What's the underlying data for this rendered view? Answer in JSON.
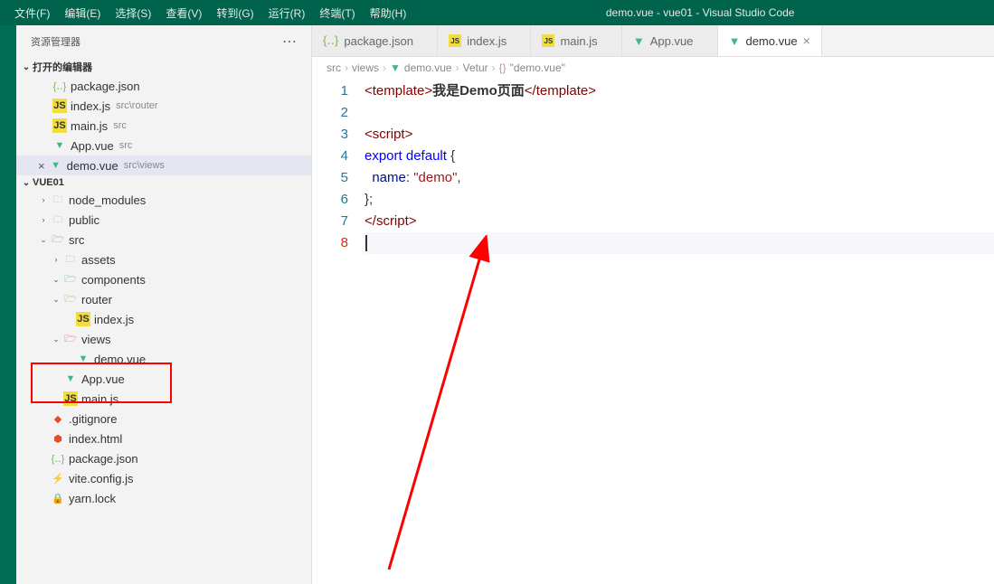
{
  "window": {
    "title": "demo.vue - vue01 - Visual Studio Code"
  },
  "menu": {
    "file": "文件(F)",
    "edit": "编辑(E)",
    "select": "选择(S)",
    "view": "查看(V)",
    "goto": "转到(G)",
    "run": "运行(R)",
    "terminal": "终端(T)",
    "help": "帮助(H)"
  },
  "sidebar": {
    "title": "资源管理器",
    "sections": {
      "open_editors": "打开的编辑器",
      "project": "VUE01"
    },
    "open_editors": [
      {
        "name": "package.json",
        "desc": "",
        "icon": "json"
      },
      {
        "name": "index.js",
        "desc": "src\\router",
        "icon": "js"
      },
      {
        "name": "main.js",
        "desc": "src",
        "icon": "js"
      },
      {
        "name": "App.vue",
        "desc": "src",
        "icon": "vue"
      },
      {
        "name": "demo.vue",
        "desc": "src\\views",
        "icon": "vue",
        "active": true
      }
    ],
    "tree": [
      {
        "label": "node_modules",
        "type": "folder",
        "indent": 1,
        "expanded": false,
        "icon": "folder"
      },
      {
        "label": "public",
        "type": "folder",
        "indent": 1,
        "expanded": false,
        "icon": "folder"
      },
      {
        "label": "src",
        "type": "folder",
        "indent": 1,
        "expanded": true,
        "icon": "src"
      },
      {
        "label": "assets",
        "type": "folder",
        "indent": 2,
        "expanded": false,
        "icon": "assets"
      },
      {
        "label": "components",
        "type": "folder",
        "indent": 2,
        "expanded": true,
        "icon": "comp"
      },
      {
        "label": "router",
        "type": "folder",
        "indent": 2,
        "expanded": true,
        "icon": "router"
      },
      {
        "label": "index.js",
        "type": "file",
        "indent": 3,
        "icon": "js"
      },
      {
        "label": "views",
        "type": "folder",
        "indent": 2,
        "expanded": true,
        "icon": "views",
        "boxed": true
      },
      {
        "label": "demo.vue",
        "type": "file",
        "indent": 3,
        "icon": "vue",
        "boxed": true
      },
      {
        "label": "App.vue",
        "type": "file",
        "indent": 2,
        "icon": "vue"
      },
      {
        "label": "main.js",
        "type": "file",
        "indent": 2,
        "icon": "js"
      },
      {
        "label": ".gitignore",
        "type": "file",
        "indent": 1,
        "icon": "git"
      },
      {
        "label": "index.html",
        "type": "file",
        "indent": 1,
        "icon": "html"
      },
      {
        "label": "package.json",
        "type": "file",
        "indent": 1,
        "icon": "json"
      },
      {
        "label": "vite.config.js",
        "type": "file",
        "indent": 1,
        "icon": "vite"
      },
      {
        "label": "yarn.lock",
        "type": "file",
        "indent": 1,
        "icon": "lock"
      }
    ]
  },
  "tabs": [
    {
      "label": "package.json",
      "icon": "json"
    },
    {
      "label": "index.js",
      "icon": "js"
    },
    {
      "label": "main.js",
      "icon": "js"
    },
    {
      "label": "App.vue",
      "icon": "vue"
    },
    {
      "label": "demo.vue",
      "icon": "vue",
      "active": true
    }
  ],
  "breadcrumb": {
    "parts": [
      {
        "label": "src"
      },
      {
        "label": "views"
      },
      {
        "label": "demo.vue",
        "icon": "vue"
      },
      {
        "label": "Vetur"
      },
      {
        "label": "\"demo.vue\"",
        "icon": "braces"
      }
    ]
  },
  "code": {
    "lines": [
      {
        "n": 1,
        "tokens": [
          [
            "<",
            "tag"
          ],
          [
            "template",
            "tag"
          ],
          [
            ">",
            "tag"
          ],
          [
            "我是Demo页面",
            "text"
          ],
          [
            "</",
            "tag"
          ],
          [
            "template",
            "tag"
          ],
          [
            ">",
            "tag"
          ]
        ]
      },
      {
        "n": 2,
        "tokens": []
      },
      {
        "n": 3,
        "tokens": [
          [
            "<",
            "tag"
          ],
          [
            "script",
            "tag"
          ],
          [
            ">",
            "tag"
          ]
        ]
      },
      {
        "n": 4,
        "tokens": [
          [
            "export",
            "keyword"
          ],
          [
            " ",
            "sp"
          ],
          [
            "default",
            "keyword"
          ],
          [
            " ",
            "sp"
          ],
          [
            "{",
            "brace"
          ]
        ]
      },
      {
        "n": 5,
        "tokens": [
          [
            "  ",
            "sp"
          ],
          [
            "name",
            "prop"
          ],
          [
            ":",
            "punct"
          ],
          [
            " ",
            "sp"
          ],
          [
            "\"demo\"",
            "string"
          ],
          [
            ",",
            "punct"
          ]
        ]
      },
      {
        "n": 6,
        "tokens": [
          [
            "}",
            "brace"
          ],
          [
            ";",
            "punct"
          ]
        ]
      },
      {
        "n": 7,
        "tokens": [
          [
            "</",
            "tag"
          ],
          [
            "script",
            "tag"
          ],
          [
            ">",
            "tag"
          ]
        ]
      },
      {
        "n": 8,
        "tokens": [],
        "current": true
      }
    ]
  }
}
